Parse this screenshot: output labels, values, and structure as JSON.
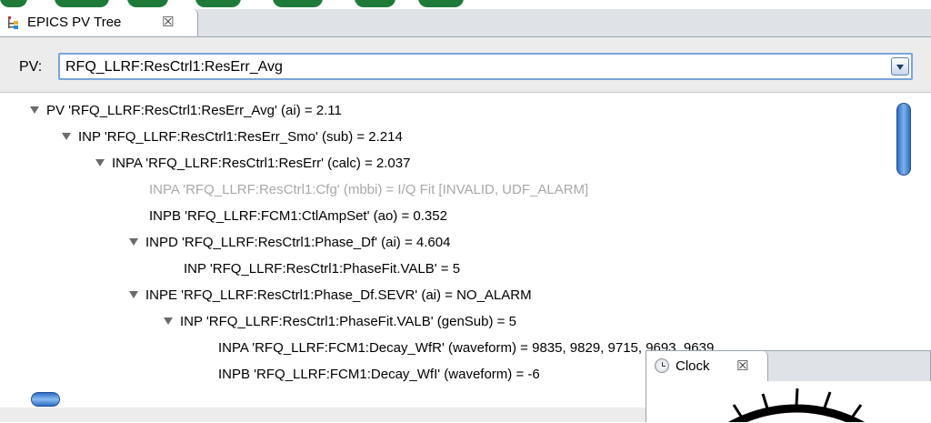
{
  "view_tab": {
    "title": "EPICS PV Tree",
    "close_glyph": "☒",
    "icon": "pv-tree-icon"
  },
  "pv": {
    "label": "PV:",
    "value": "RFQ_LLRF:ResCtrl1:ResErr_Avg"
  },
  "tree": [
    {
      "text": "PV 'RFQ_LLRF:ResCtrl1:ResErr_Avg'  (ai)  =  2.11",
      "expanded": true,
      "dim": false
    },
    {
      "text": "INP 'RFQ_LLRF:ResCtrl1:ResErr_Smo'  (sub)  =  2.214",
      "expanded": true,
      "dim": false
    },
    {
      "text": "INPA 'RFQ_LLRF:ResCtrl1:ResErr'  (calc)  =  2.037",
      "expanded": true,
      "dim": false
    },
    {
      "text": "INPA 'RFQ_LLRF:ResCtrl1:Cfg'  (mbbi)  =  I/Q Fit [INVALID, UDF_ALARM]",
      "expanded": false,
      "dim": true
    },
    {
      "text": "INPB 'RFQ_LLRF:FCM1:CtlAmpSet'  (ao)  =  0.352",
      "expanded": false,
      "dim": false
    },
    {
      "text": "INPD 'RFQ_LLRF:ResCtrl1:Phase_Df'  (ai)  =  4.604",
      "expanded": true,
      "dim": false
    },
    {
      "text": "INP 'RFQ_LLRF:ResCtrl1:PhaseFit.VALB'  =  5",
      "expanded": false,
      "dim": false
    },
    {
      "text": "INPE 'RFQ_LLRF:ResCtrl1:Phase_Df.SEVR'  (ai)  =  NO_ALARM",
      "expanded": true,
      "dim": false
    },
    {
      "text": "INP 'RFQ_LLRF:ResCtrl1:PhaseFit.VALB'  (genSub)  =  5",
      "expanded": true,
      "dim": false
    },
    {
      "text": "INPA 'RFQ_LLRF:FCM1:Decay_WfR'  (waveform)  =  9835, 9829, 9715, 9693, 9639",
      "expanded": false,
      "dim": false
    },
    {
      "text": "INPB 'RFQ_LLRF:FCM1:Decay_WfI'  (waveform)  =  -6",
      "expanded": false,
      "dim": false
    }
  ],
  "clock_view": {
    "title": "Clock",
    "close_glyph": "☒",
    "icon": "clock-icon"
  }
}
